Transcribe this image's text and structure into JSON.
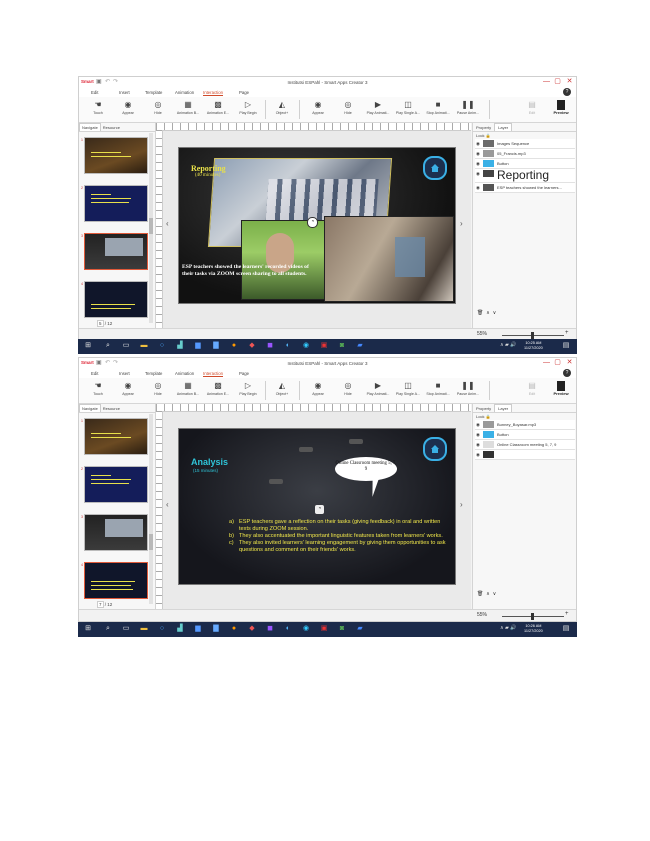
{
  "app": {
    "logo": "Smart",
    "title": "Institutsi ESPahl - Smart Apps Creator 3",
    "window_buttons": [
      "—",
      "▢",
      "✕"
    ]
  },
  "menu": {
    "items": [
      "Edit",
      "Insert",
      "Template",
      "Animation",
      "Interaction",
      "Page"
    ],
    "active": "Interaction"
  },
  "ribbon": {
    "tools": [
      "Touch",
      "Appear",
      "Hide",
      "Animation B...",
      "Animation E...",
      "Play Begin",
      "Object+",
      "Appear",
      "Hide",
      "Play Animati...",
      "Play Single A...",
      "Stop Animati...",
      "Pause Anim..."
    ],
    "edit_label": "Edit",
    "preview_label": "Preview"
  },
  "left_panel": {
    "tabs": [
      "Navigate",
      "Resource"
    ],
    "thumb_numbers": [
      "1",
      "2",
      "3",
      "4"
    ]
  },
  "right_panel": {
    "tabs": [
      "Property",
      "Layer"
    ],
    "lock_label": "Lock"
  },
  "screen1": {
    "slide": {
      "heading": "Reporting",
      "subheading": "(40 minutes)",
      "caption": "ESP teachers showed the learners' recorded videos of their tasks via ZOOM screen sharing to all students."
    },
    "layers": [
      {
        "name": "Images Sequence"
      },
      {
        "name": "05_Francis.mp3"
      },
      {
        "name": "Button"
      },
      {
        "name": "Reporting"
      },
      {
        "name": "ESP teachers showed the learners..."
      }
    ],
    "pager": {
      "current": "5",
      "total": "12"
    },
    "zoom": "55%",
    "clock_time": "10:25 AM",
    "clock_date": "11/27/2020"
  },
  "screen2": {
    "slide": {
      "heading": "Analysis",
      "subheading": "(15 minutes)",
      "bubble": "Online Classroom meeting 5, 7, 9",
      "points": [
        {
          "marker": "a)",
          "text": "ESP teachers gave a reflection on their tasks (giving feedback) in oral and written texts during ZOOM session."
        },
        {
          "marker": "b)",
          "text": "They also accentuated the important linguistic features taken from learners' works."
        },
        {
          "marker": "c)",
          "text": "They also invited learners' learning engagement by giving them opportunities to ask questions and comment on their friends' works."
        }
      ]
    },
    "layers": [
      {
        "name": "Bunney_Boyasar.mp3"
      },
      {
        "name": "Button"
      },
      {
        "name": "Online Classroom meeting 5, 7, 9"
      },
      {
        "name": ""
      }
    ],
    "pager": {
      "current": "7",
      "total": "12"
    },
    "zoom": "55%",
    "clock_time": "10:26 AM",
    "clock_date": "11/27/2020"
  }
}
